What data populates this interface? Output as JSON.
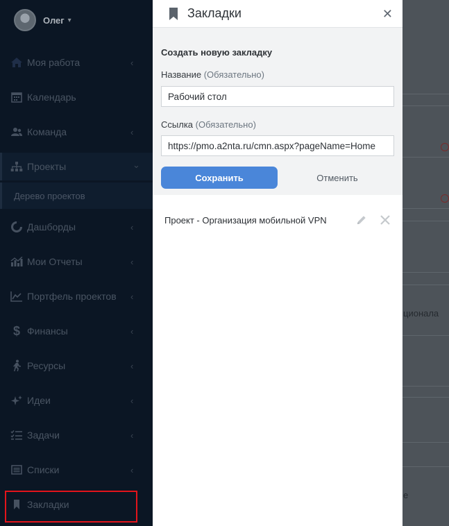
{
  "user": {
    "name": "Олег",
    "caret": "▾"
  },
  "sidebar": {
    "items": [
      {
        "label": "Моя работа",
        "icon": "home-icon"
      },
      {
        "label": "Календарь",
        "icon": "calendar-icon"
      },
      {
        "label": "Команда",
        "icon": "team-icon"
      },
      {
        "label": "Проекты",
        "icon": "sitemap-icon"
      },
      {
        "label": "Дашборды",
        "icon": "pie-icon"
      },
      {
        "label": "Мои Отчеты",
        "icon": "reports-icon"
      },
      {
        "label": "Портфель проектов",
        "icon": "portfolio-icon"
      },
      {
        "label": "Финансы",
        "icon": "dollar-icon"
      },
      {
        "label": "Ресурсы",
        "icon": "runner-icon"
      },
      {
        "label": "Идеи",
        "icon": "sparkle-icon"
      },
      {
        "label": "Задачи",
        "icon": "tasks-icon"
      },
      {
        "label": "Списки",
        "icon": "list-icon"
      },
      {
        "label": "Закладки",
        "icon": "bookmark-icon"
      }
    ],
    "sub_item": "Дерево проектов",
    "chevron_collapsed": "‹",
    "chevron_expanded": "⌄"
  },
  "background": {
    "text_1": "ционала",
    "text_2": "е"
  },
  "panel": {
    "title": "Закладки",
    "close": "✕",
    "form": {
      "heading": "Создать новую закладку",
      "name_label": "Название",
      "name_required": "(Обязательно)",
      "name_value": "Рабочий стол",
      "link_label": "Ссылка",
      "link_required": "(Обязательно)",
      "link_value": "https://pmo.a2nta.ru/cmn.aspx?pageName=Home",
      "save": "Сохранить",
      "cancel": "Отменить"
    },
    "bookmarks": [
      {
        "label": "Проект - Организация мобильной VPN"
      }
    ]
  },
  "colors": {
    "accent": "#4a86d9",
    "sidebar_bg": "#0b1624",
    "highlight": "#e3141b"
  }
}
